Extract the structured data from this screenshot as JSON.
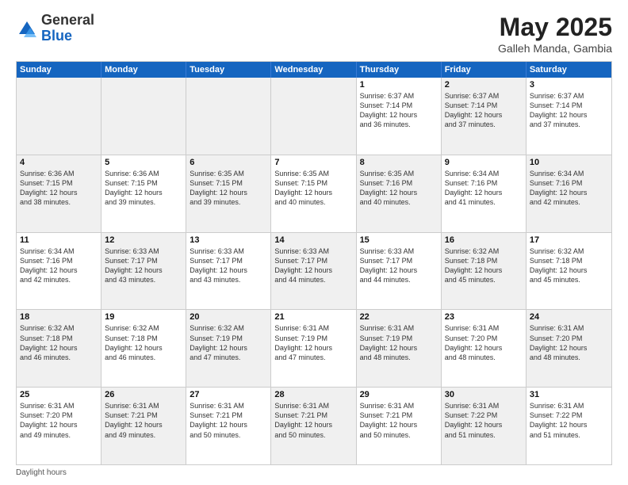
{
  "logo": {
    "general": "General",
    "blue": "Blue"
  },
  "title": {
    "month": "May 2025",
    "location": "Galleh Manda, Gambia"
  },
  "header_days": [
    "Sunday",
    "Monday",
    "Tuesday",
    "Wednesday",
    "Thursday",
    "Friday",
    "Saturday"
  ],
  "weeks": [
    [
      {
        "day": "",
        "info": "",
        "shaded": true
      },
      {
        "day": "",
        "info": "",
        "shaded": true
      },
      {
        "day": "",
        "info": "",
        "shaded": true
      },
      {
        "day": "",
        "info": "",
        "shaded": true
      },
      {
        "day": "1",
        "info": "Sunrise: 6:37 AM\nSunset: 7:14 PM\nDaylight: 12 hours\nand 36 minutes."
      },
      {
        "day": "2",
        "info": "Sunrise: 6:37 AM\nSunset: 7:14 PM\nDaylight: 12 hours\nand 37 minutes.",
        "shaded": true
      },
      {
        "day": "3",
        "info": "Sunrise: 6:37 AM\nSunset: 7:14 PM\nDaylight: 12 hours\nand 37 minutes."
      }
    ],
    [
      {
        "day": "4",
        "info": "Sunrise: 6:36 AM\nSunset: 7:15 PM\nDaylight: 12 hours\nand 38 minutes.",
        "shaded": true
      },
      {
        "day": "5",
        "info": "Sunrise: 6:36 AM\nSunset: 7:15 PM\nDaylight: 12 hours\nand 39 minutes."
      },
      {
        "day": "6",
        "info": "Sunrise: 6:35 AM\nSunset: 7:15 PM\nDaylight: 12 hours\nand 39 minutes.",
        "shaded": true
      },
      {
        "day": "7",
        "info": "Sunrise: 6:35 AM\nSunset: 7:15 PM\nDaylight: 12 hours\nand 40 minutes."
      },
      {
        "day": "8",
        "info": "Sunrise: 6:35 AM\nSunset: 7:16 PM\nDaylight: 12 hours\nand 40 minutes.",
        "shaded": true
      },
      {
        "day": "9",
        "info": "Sunrise: 6:34 AM\nSunset: 7:16 PM\nDaylight: 12 hours\nand 41 minutes."
      },
      {
        "day": "10",
        "info": "Sunrise: 6:34 AM\nSunset: 7:16 PM\nDaylight: 12 hours\nand 42 minutes.",
        "shaded": true
      }
    ],
    [
      {
        "day": "11",
        "info": "Sunrise: 6:34 AM\nSunset: 7:16 PM\nDaylight: 12 hours\nand 42 minutes."
      },
      {
        "day": "12",
        "info": "Sunrise: 6:33 AM\nSunset: 7:17 PM\nDaylight: 12 hours\nand 43 minutes.",
        "shaded": true
      },
      {
        "day": "13",
        "info": "Sunrise: 6:33 AM\nSunset: 7:17 PM\nDaylight: 12 hours\nand 43 minutes."
      },
      {
        "day": "14",
        "info": "Sunrise: 6:33 AM\nSunset: 7:17 PM\nDaylight: 12 hours\nand 44 minutes.",
        "shaded": true
      },
      {
        "day": "15",
        "info": "Sunrise: 6:33 AM\nSunset: 7:17 PM\nDaylight: 12 hours\nand 44 minutes."
      },
      {
        "day": "16",
        "info": "Sunrise: 6:32 AM\nSunset: 7:18 PM\nDaylight: 12 hours\nand 45 minutes.",
        "shaded": true
      },
      {
        "day": "17",
        "info": "Sunrise: 6:32 AM\nSunset: 7:18 PM\nDaylight: 12 hours\nand 45 minutes."
      }
    ],
    [
      {
        "day": "18",
        "info": "Sunrise: 6:32 AM\nSunset: 7:18 PM\nDaylight: 12 hours\nand 46 minutes.",
        "shaded": true
      },
      {
        "day": "19",
        "info": "Sunrise: 6:32 AM\nSunset: 7:18 PM\nDaylight: 12 hours\nand 46 minutes."
      },
      {
        "day": "20",
        "info": "Sunrise: 6:32 AM\nSunset: 7:19 PM\nDaylight: 12 hours\nand 47 minutes.",
        "shaded": true
      },
      {
        "day": "21",
        "info": "Sunrise: 6:31 AM\nSunset: 7:19 PM\nDaylight: 12 hours\nand 47 minutes."
      },
      {
        "day": "22",
        "info": "Sunrise: 6:31 AM\nSunset: 7:19 PM\nDaylight: 12 hours\nand 48 minutes.",
        "shaded": true
      },
      {
        "day": "23",
        "info": "Sunrise: 6:31 AM\nSunset: 7:20 PM\nDaylight: 12 hours\nand 48 minutes."
      },
      {
        "day": "24",
        "info": "Sunrise: 6:31 AM\nSunset: 7:20 PM\nDaylight: 12 hours\nand 48 minutes.",
        "shaded": true
      }
    ],
    [
      {
        "day": "25",
        "info": "Sunrise: 6:31 AM\nSunset: 7:20 PM\nDaylight: 12 hours\nand 49 minutes."
      },
      {
        "day": "26",
        "info": "Sunrise: 6:31 AM\nSunset: 7:21 PM\nDaylight: 12 hours\nand 49 minutes.",
        "shaded": true
      },
      {
        "day": "27",
        "info": "Sunrise: 6:31 AM\nSunset: 7:21 PM\nDaylight: 12 hours\nand 50 minutes."
      },
      {
        "day": "28",
        "info": "Sunrise: 6:31 AM\nSunset: 7:21 PM\nDaylight: 12 hours\nand 50 minutes.",
        "shaded": true
      },
      {
        "day": "29",
        "info": "Sunrise: 6:31 AM\nSunset: 7:21 PM\nDaylight: 12 hours\nand 50 minutes."
      },
      {
        "day": "30",
        "info": "Sunrise: 6:31 AM\nSunset: 7:22 PM\nDaylight: 12 hours\nand 51 minutes.",
        "shaded": true
      },
      {
        "day": "31",
        "info": "Sunrise: 6:31 AM\nSunset: 7:22 PM\nDaylight: 12 hours\nand 51 minutes."
      }
    ]
  ],
  "footer": "Daylight hours"
}
